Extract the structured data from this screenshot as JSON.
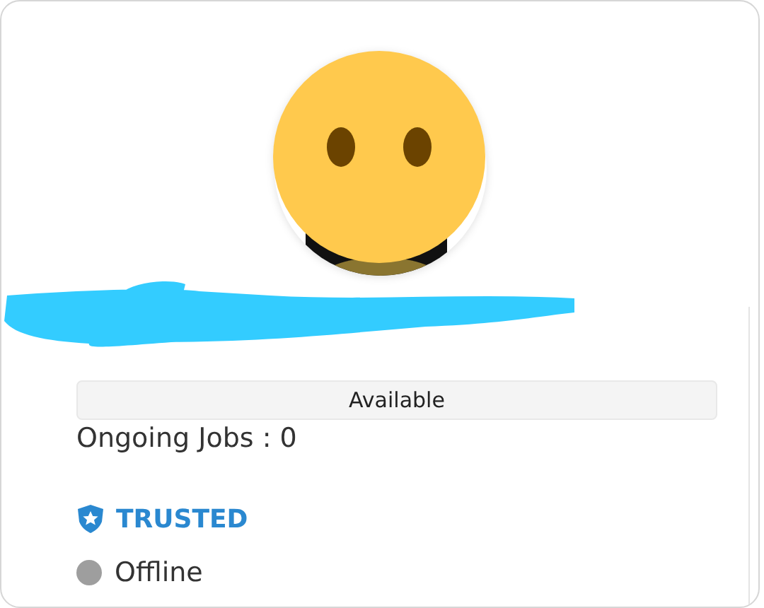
{
  "profile": {
    "avatar": {
      "kind": "emoji"
    },
    "name_redacted": true,
    "availability": "Available",
    "ongoing_jobs": "Ongoing Jobs : 0",
    "trusted": {
      "label": "TRUSTED",
      "on": true
    },
    "presence": {
      "label": "Offline",
      "color": "#9e9e9e"
    }
  }
}
